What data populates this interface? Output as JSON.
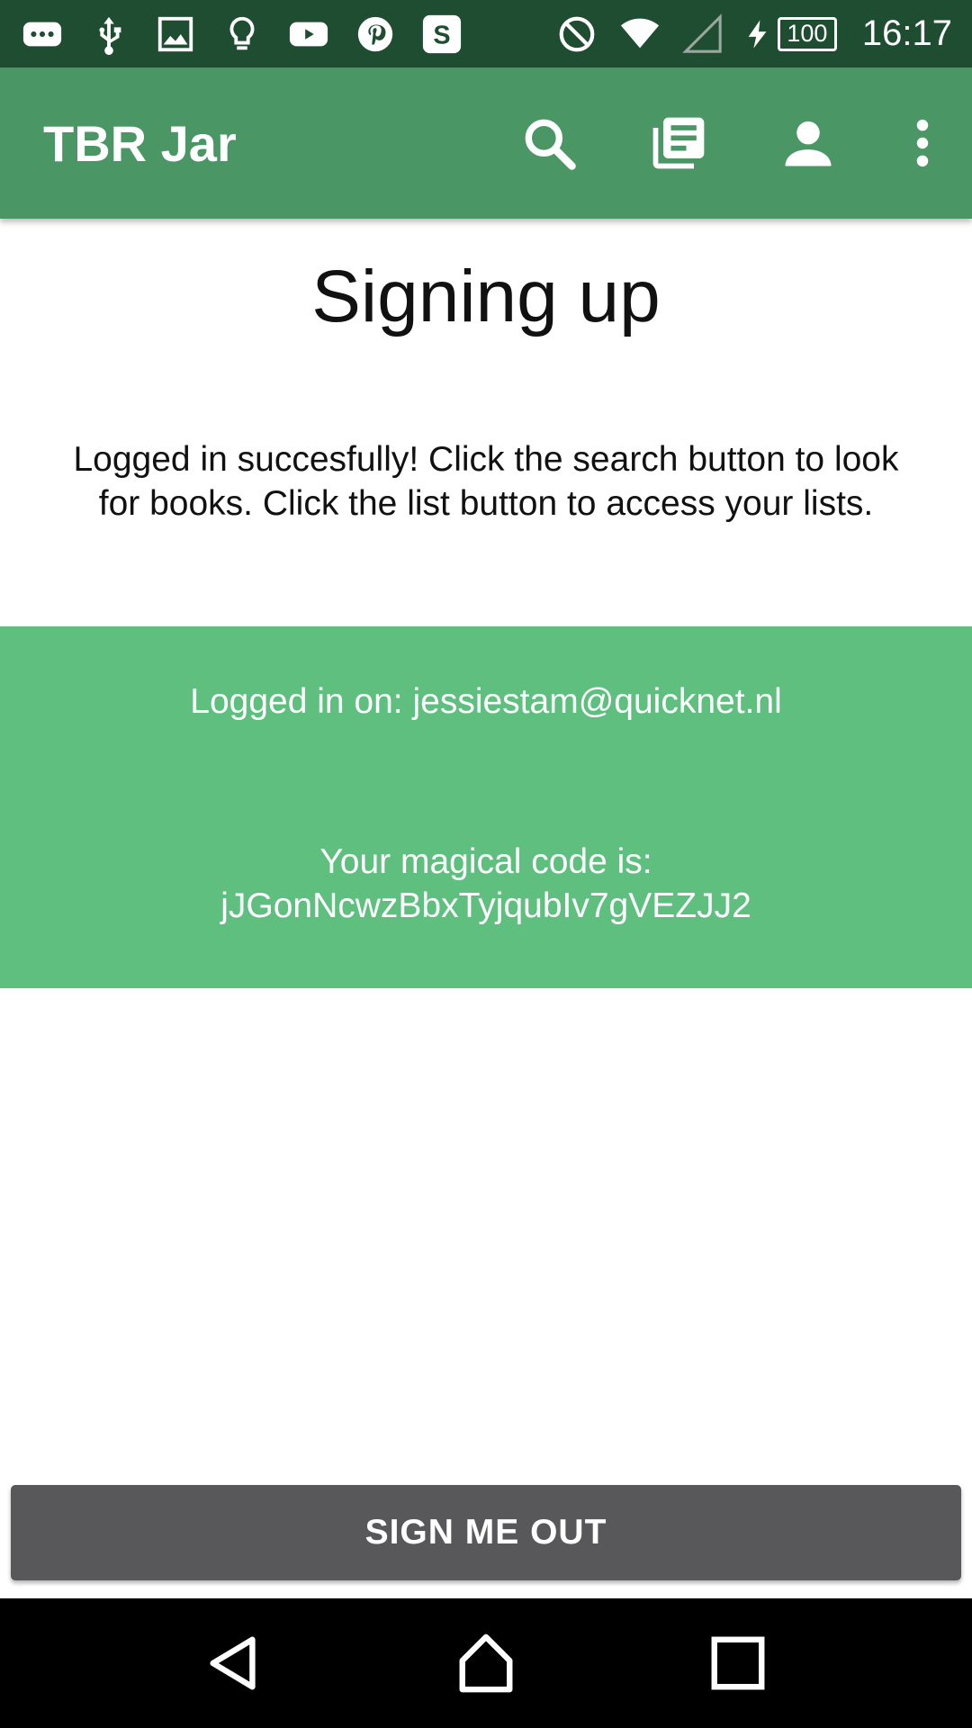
{
  "status_bar": {
    "battery_level": "100",
    "time": "16:17",
    "notification_icons": [
      "messages-icon",
      "usb-icon",
      "gallery-icon",
      "bulb-icon",
      "youtube-icon",
      "pinterest-icon",
      "s-app-icon"
    ],
    "s_app_letter": "S"
  },
  "app_bar": {
    "title": "TBR Jar",
    "actions": [
      "search-icon",
      "library-icon",
      "account-icon",
      "overflow-menu-icon"
    ]
  },
  "main": {
    "title": "Signing up",
    "message": "Logged in succesfully! Click the search button to look for books. Click the list button to access your lists.",
    "logged_in_text": "Logged in on: jessiestam@quicknet.nl",
    "code_label": "Your magical code is:",
    "code_value": "jJGonNcwzBbxTyjqubIv7gVEZJJ2"
  },
  "sign_out_label": "SIGN ME OUT",
  "nav_bar": {
    "buttons": [
      "back-icon",
      "home-icon",
      "recents-icon"
    ]
  },
  "colors": {
    "status_bar": "#1f4d31",
    "app_bar": "#4a9765",
    "info_panel": "#5ebf7e",
    "button": "#58585a"
  }
}
